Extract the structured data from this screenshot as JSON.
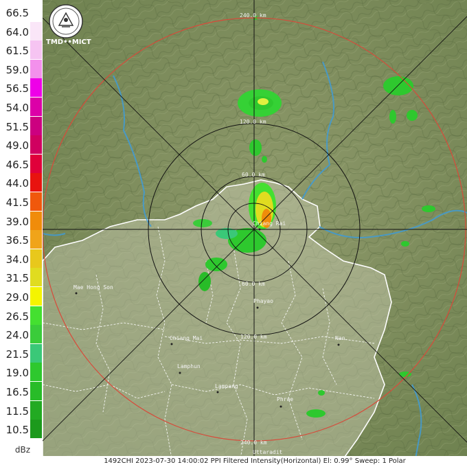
{
  "legend": {
    "unit": "dBz",
    "levels": [
      {
        "label": "66.5",
        "color": "#ffffff"
      },
      {
        "label": "64.0",
        "color": "#fae6f8"
      },
      {
        "label": "61.5",
        "color": "#f6c4f2"
      },
      {
        "label": "59.0",
        "color": "#f390ec"
      },
      {
        "label": "56.5",
        "color": "#ee00e8"
      },
      {
        "label": "54.0",
        "color": "#dc00a8"
      },
      {
        "label": "51.5",
        "color": "#cc0080"
      },
      {
        "label": "49.0",
        "color": "#d00060"
      },
      {
        "label": "46.5",
        "color": "#e0003a"
      },
      {
        "label": "44.0",
        "color": "#e8130f"
      },
      {
        "label": "41.5",
        "color": "#f0580c"
      },
      {
        "label": "39.0",
        "color": "#f08c0a"
      },
      {
        "label": "36.5",
        "color": "#f0a41a"
      },
      {
        "label": "34.0",
        "color": "#e8c81c"
      },
      {
        "label": "31.5",
        "color": "#e0dc20"
      },
      {
        "label": "29.0",
        "color": "#f4f400"
      },
      {
        "label": "26.5",
        "color": "#44e030"
      },
      {
        "label": "24.0",
        "color": "#3acc3a"
      },
      {
        "label": "21.5",
        "color": "#3ac878"
      },
      {
        "label": "19.0",
        "color": "#2ec82e"
      },
      {
        "label": "16.5",
        "color": "#28bc28"
      },
      {
        "label": "11.5",
        "color": "#22aa22"
      },
      {
        "label": "10.5",
        "color": "#1c9a1c"
      }
    ]
  },
  "logo": {
    "text": "TMD••MICT"
  },
  "rings": [
    {
      "label": "240.0 km"
    },
    {
      "label": "120.0 km"
    },
    {
      "label": "60.0 km"
    },
    {
      "label": "60.0 km"
    },
    {
      "label": "120.0 km"
    },
    {
      "label": "240.0 km"
    }
  ],
  "places": [
    {
      "name": "Chiang Rai"
    },
    {
      "name": "Mae Hong Son"
    },
    {
      "name": "Phayao"
    },
    {
      "name": "Chiang Mai"
    },
    {
      "name": "Nan"
    },
    {
      "name": "Lamphun"
    },
    {
      "name": "Lampang"
    },
    {
      "name": "Phrae"
    },
    {
      "name": "Uttaradit"
    }
  ],
  "footer": "1492CHI 2023-07-30 14:00:02 PPI Filtered Intensity(Horizontal)  El: 0.99°  Sweep: 1 Polar"
}
